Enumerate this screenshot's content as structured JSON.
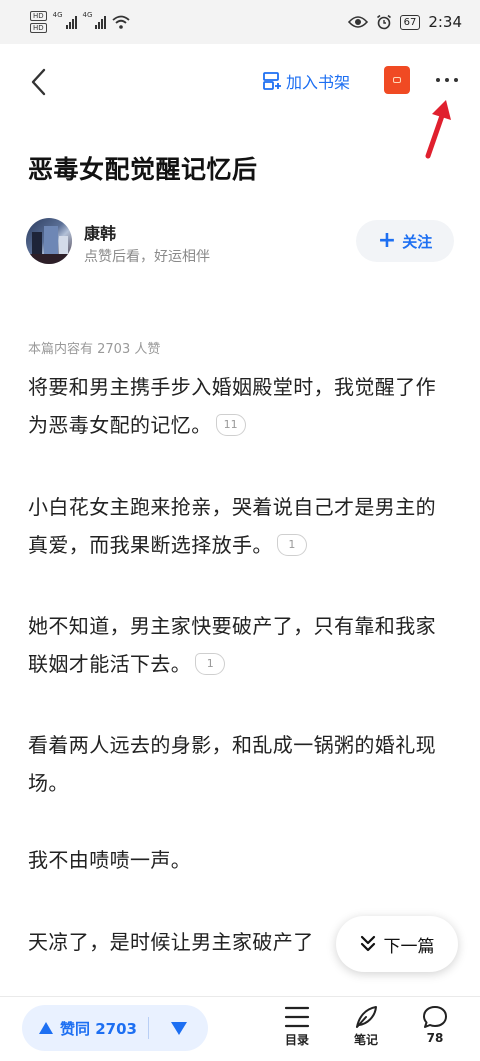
{
  "status_bar": {
    "hd_badges": [
      "HD",
      "HD"
    ],
    "net_1": "4G",
    "net_2": "4G",
    "battery": "67",
    "time": "2:34"
  },
  "nav": {
    "add_bookshelf_label": "加入书架"
  },
  "article": {
    "title": "恶毒女配觉醒记忆后",
    "likes_line": "本篇内容有 2703 人赞",
    "paragraphs": [
      {
        "text": "将要和男主携手步入婚姻殿堂时，我觉醒了作为恶毒女配的记忆。",
        "comments": "11"
      },
      {
        "text": "小白花女主跑来抢亲，哭着说自己才是男主的真爱，而我果断选择放手。",
        "comments": "1"
      },
      {
        "text": "她不知道，男主家快要破产了，只有靠和我家联姻才能活下去。",
        "comments": "1"
      },
      {
        "text": "看着两人远去的身影，和乱成一锅粥的婚礼现场。"
      },
      {
        "text": "我不由啧啧一声。"
      },
      {
        "text": "天凉了，是时候让男主家破产了"
      }
    ]
  },
  "author": {
    "name": "康韩",
    "bio": "点赞后看，好运相伴",
    "follow_label": "关注"
  },
  "next_chapter": {
    "label": "下一篇"
  },
  "bottom_bar": {
    "vote_label": "赞同 2703",
    "toc_label": "目录",
    "notes_label": "笔记",
    "comments_count": "78"
  },
  "colors": {
    "accent": "#1d6ff2",
    "annotation_arrow": "#e0202e",
    "redpack": "#f04a23"
  }
}
